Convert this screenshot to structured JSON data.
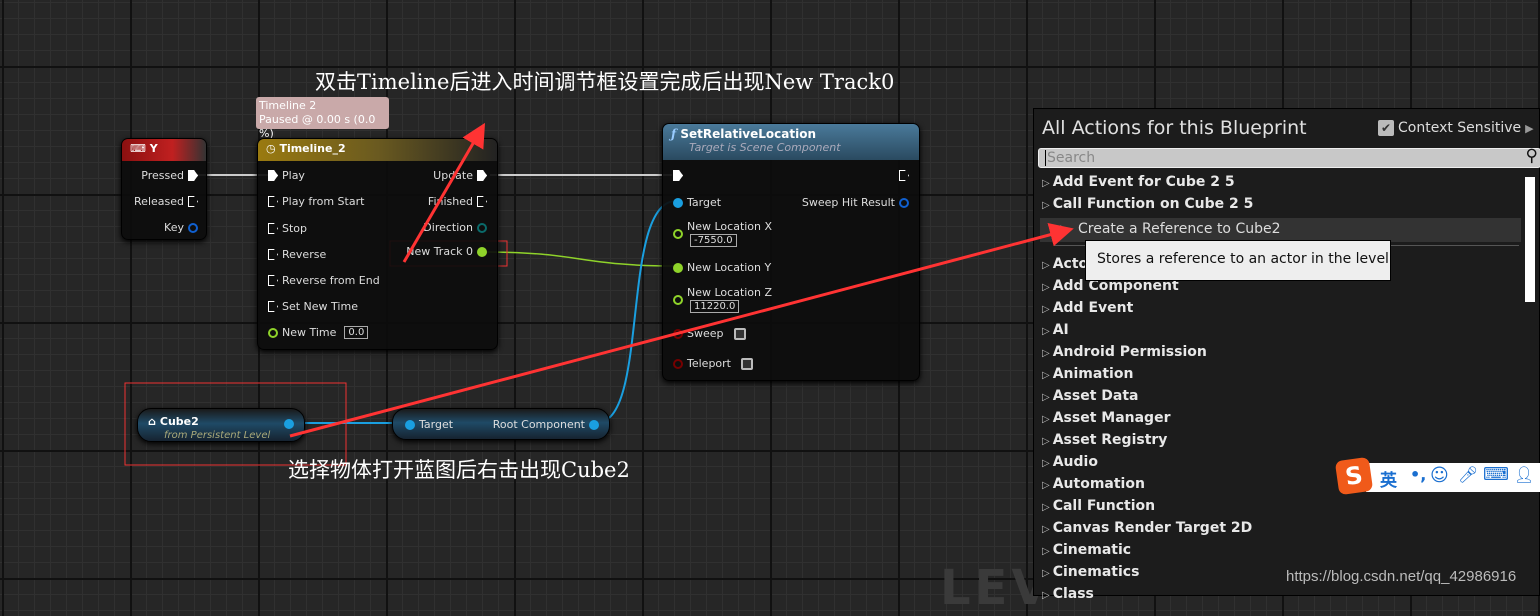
{
  "annotations": {
    "top": "双击Timeline后进入时间调节框设置完成后出现New Track0",
    "bottom": "选择物体打开蓝图后右击出现Cube2",
    "arrow_color": "#ff3333"
  },
  "key_node": {
    "title": "Y",
    "pins": [
      "Pressed",
      "Released",
      "Key"
    ]
  },
  "timeline_tooltip": {
    "line1": "Timeline 2",
    "line2": "Paused @ 0.00 s (0.0 %)"
  },
  "timeline_node": {
    "title": "Timeline_2",
    "inputs": [
      "Play",
      "Play from Start",
      "Stop",
      "Reverse",
      "Reverse from End",
      "Set New Time"
    ],
    "new_time_label": "New Time",
    "new_time_value": "0.0",
    "outputs": [
      "Update",
      "Finished",
      "Direction",
      "New Track 0"
    ]
  },
  "set_location_node": {
    "title": "SetRelativeLocation",
    "subtitle": "Target is Scene Component",
    "target": "Target",
    "sweep_hit": "Sweep Hit Result",
    "x_label": "New Location X",
    "x_value": "-7550.0",
    "y_label": "New Location Y",
    "z_label": "New Location Z",
    "z_value": "11220.0",
    "sweep": "Sweep",
    "teleport": "Teleport"
  },
  "cube_node": {
    "title": "Cube2",
    "subtitle": "from Persistent Level"
  },
  "root_node": {
    "target": "Target",
    "output": "Root Component"
  },
  "panel": {
    "title": "All Actions for this Blueprint",
    "context_sensitive": "Context Sensitive",
    "context_checked": true,
    "search_placeholder": "Search",
    "top_items": [
      "Add Event for Cube 2 5",
      "Call Function on Cube 2 5"
    ],
    "selected_item": "Create a Reference to Cube2",
    "tooltip": "Stores a reference to an actor in the level",
    "items": [
      "Actor",
      "Add Component",
      "Add Event",
      "AI",
      "Android Permission",
      "Animation",
      "Asset Data",
      "Asset Manager",
      "Asset Registry",
      "Audio",
      "Automation",
      "Call Function",
      "Canvas Render Target 2D",
      "Cinematic",
      "Cinematics",
      "Class"
    ]
  },
  "ime": {
    "mode": "英"
  },
  "watermark": "https://blog.csdn.net/qq_42986916"
}
